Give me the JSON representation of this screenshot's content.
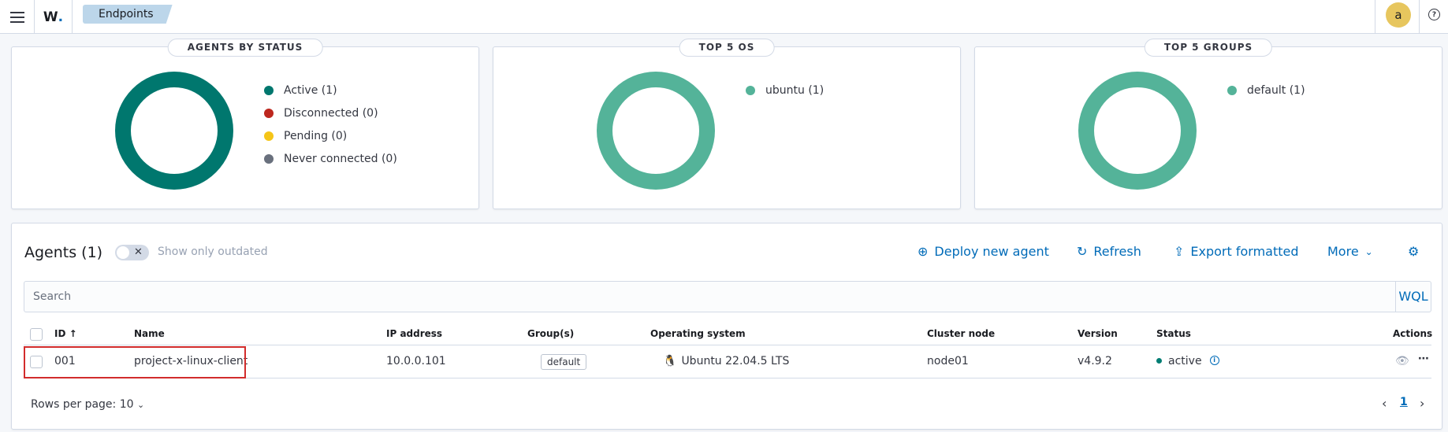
{
  "header": {
    "breadcrumb": "Endpoints",
    "avatar_letter": "a",
    "help_glyph": "?"
  },
  "panels": [
    {
      "title": "AGENTS BY STATUS",
      "ring_color": "#00776e",
      "legend": [
        {
          "label": "Active (1)",
          "color": "#00776e"
        },
        {
          "label": "Disconnected (0)",
          "color": "#bd271e"
        },
        {
          "label": "Pending (0)",
          "color": "#f5c518"
        },
        {
          "label": "Never connected (0)",
          "color": "#69707d"
        }
      ]
    },
    {
      "title": "TOP 5 OS",
      "ring_color": "#54b399",
      "legend": [
        {
          "label": "ubuntu (1)",
          "color": "#54b399"
        }
      ]
    },
    {
      "title": "TOP 5 GROUPS",
      "ring_color": "#54b399",
      "legend": [
        {
          "label": "default (1)",
          "color": "#54b399"
        }
      ]
    }
  ],
  "agents": {
    "title": "Agents (1)",
    "toggle_label": "Show only outdated",
    "actions": {
      "deploy": "Deploy new agent",
      "refresh": "Refresh",
      "export": "Export formatted",
      "more": "More"
    },
    "search": {
      "placeholder": "Search",
      "wql": "WQL"
    },
    "columns": {
      "id": "ID",
      "name": "Name",
      "ip": "IP address",
      "groups": "Group(s)",
      "os": "Operating system",
      "cluster": "Cluster node",
      "version": "Version",
      "status": "Status",
      "actions": "Actions"
    },
    "rows": [
      {
        "id": "001",
        "name": "project-x-linux-client",
        "ip": "10.0.0.101",
        "group": "default",
        "os": "Ubuntu 22.04.5 LTS",
        "cluster": "node01",
        "version": "v4.9.2",
        "status": "active"
      }
    ],
    "rows_per_page": "Rows per page: 10",
    "current_page": "1"
  }
}
